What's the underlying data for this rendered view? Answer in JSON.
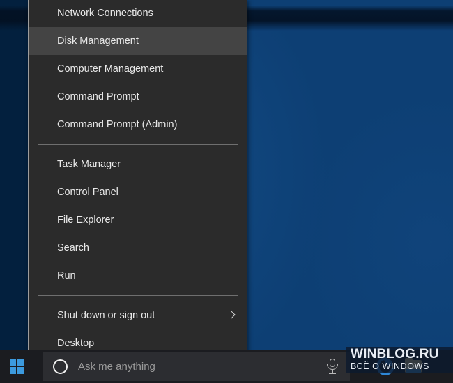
{
  "desktop": {
    "wallpaper_color": "#0d3f74",
    "accent_color": "#3c9ade"
  },
  "winx_menu": {
    "name": "Win+X power user menu",
    "background_color": "#2b2b2b",
    "highlight_color": "#444444",
    "border_color": "#9d9d9d",
    "groups": [
      {
        "items": [
          {
            "label": "Network Connections",
            "highlighted": false,
            "has_submenu": false
          },
          {
            "label": "Disk Management",
            "highlighted": true,
            "has_submenu": false
          },
          {
            "label": "Computer Management",
            "highlighted": false,
            "has_submenu": false
          },
          {
            "label": "Command Prompt",
            "highlighted": false,
            "has_submenu": false
          },
          {
            "label": "Command Prompt (Admin)",
            "highlighted": false,
            "has_submenu": false
          }
        ]
      },
      {
        "items": [
          {
            "label": "Task Manager",
            "highlighted": false,
            "has_submenu": false
          },
          {
            "label": "Control Panel",
            "highlighted": false,
            "has_submenu": false
          },
          {
            "label": "File Explorer",
            "highlighted": false,
            "has_submenu": false
          },
          {
            "label": "Search",
            "highlighted": false,
            "has_submenu": false
          },
          {
            "label": "Run",
            "highlighted": false,
            "has_submenu": false
          }
        ]
      },
      {
        "items": [
          {
            "label": "Shut down or sign out",
            "highlighted": false,
            "has_submenu": true
          },
          {
            "label": "Desktop",
            "highlighted": false,
            "has_submenu": false
          }
        ]
      }
    ]
  },
  "taskbar": {
    "background_color": "#1b1c20",
    "start_button": {
      "icon": "windows-logo-icon",
      "label": "Start"
    },
    "search": {
      "placeholder": "Ask me anything",
      "cortana_icon": "cortana-ring-icon",
      "mic_icon": "microphone-icon"
    },
    "pinned_apps": [
      {
        "icon": "edge-icon",
        "label": "Microsoft Edge"
      },
      {
        "icon": "file-explorer-icon",
        "label": "File Explorer"
      }
    ]
  },
  "watermark": {
    "title": "WINBLOG.RU",
    "subtitle": "ВСЁ О WINDOWS"
  }
}
